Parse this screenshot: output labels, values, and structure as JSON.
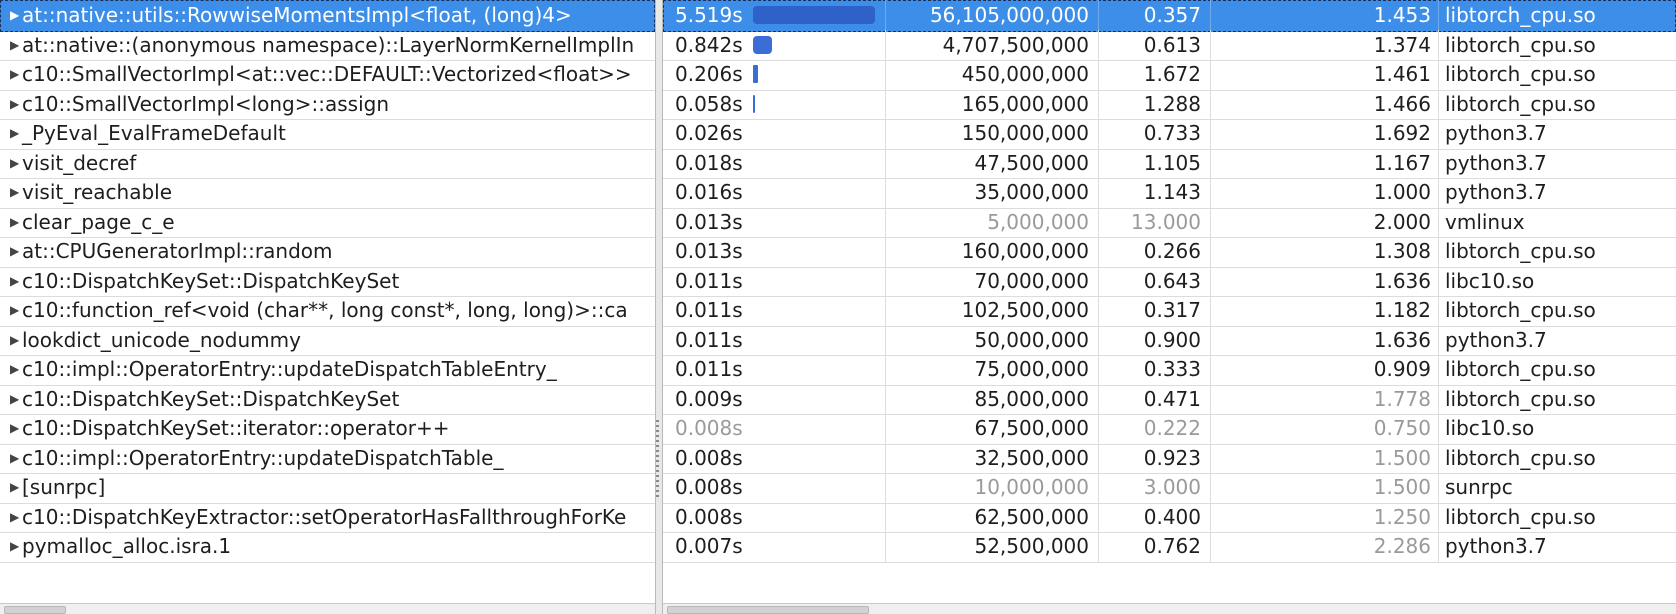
{
  "rows": [
    {
      "name": "at::native::utils::RowwiseMomentsImpl<float, (long)4>",
      "time": "5.519s",
      "time_frac": 1.0,
      "count": "56,105,000,000",
      "ipc": "0.357",
      "cpi": "1.453",
      "module": "libtorch_cpu.so",
      "selected": true
    },
    {
      "name": "at::native::(anonymous namespace)::LayerNormKernelImplIn",
      "time": "0.842s",
      "time_frac": 0.153,
      "count": "4,707,500,000",
      "ipc": "0.613",
      "cpi": "1.374",
      "module": "libtorch_cpu.so"
    },
    {
      "name": "c10::SmallVectorImpl<at::vec::DEFAULT::Vectorized<float>>",
      "time": "0.206s",
      "time_frac": 0.037,
      "count": "450,000,000",
      "ipc": "1.672",
      "cpi": "1.461",
      "module": "libtorch_cpu.so"
    },
    {
      "name": "c10::SmallVectorImpl<long>::assign",
      "time": "0.058s",
      "time_frac": 0.011,
      "count": "165,000,000",
      "ipc": "1.288",
      "cpi": "1.466",
      "module": "libtorch_cpu.so"
    },
    {
      "name": "_PyEval_EvalFrameDefault",
      "time": "0.026s",
      "time_frac": 0,
      "count": "150,000,000",
      "ipc": "0.733",
      "cpi": "1.692",
      "module": "python3.7"
    },
    {
      "name": "visit_decref",
      "time": "0.018s",
      "time_frac": 0,
      "count": "47,500,000",
      "ipc": "1.105",
      "cpi": "1.167",
      "module": "python3.7"
    },
    {
      "name": "visit_reachable",
      "time": "0.016s",
      "time_frac": 0,
      "count": "35,000,000",
      "ipc": "1.143",
      "cpi": "1.000",
      "module": "python3.7"
    },
    {
      "name": "clear_page_c_e",
      "time": "0.013s",
      "time_frac": 0,
      "count": "5,000,000",
      "ipc": "13.000",
      "cpi": "2.000",
      "module": "vmlinux",
      "dim": [
        "count",
        "ipc"
      ]
    },
    {
      "name": "at::CPUGeneratorImpl::random",
      "time": "0.013s",
      "time_frac": 0,
      "count": "160,000,000",
      "ipc": "0.266",
      "cpi": "1.308",
      "module": "libtorch_cpu.so"
    },
    {
      "name": "c10::DispatchKeySet::DispatchKeySet",
      "time": "0.011s",
      "time_frac": 0,
      "count": "70,000,000",
      "ipc": "0.643",
      "cpi": "1.636",
      "module": "libc10.so"
    },
    {
      "name": "c10::function_ref<void (char**, long const*, long, long)>::ca",
      "time": "0.011s",
      "time_frac": 0,
      "count": "102,500,000",
      "ipc": "0.317",
      "cpi": "1.182",
      "module": "libtorch_cpu.so"
    },
    {
      "name": "lookdict_unicode_nodummy",
      "time": "0.011s",
      "time_frac": 0,
      "count": "50,000,000",
      "ipc": "0.900",
      "cpi": "1.636",
      "module": "python3.7"
    },
    {
      "name": "c10::impl::OperatorEntry::updateDispatchTableEntry_",
      "time": "0.011s",
      "time_frac": 0,
      "count": "75,000,000",
      "ipc": "0.333",
      "cpi": "0.909",
      "module": "libtorch_cpu.so"
    },
    {
      "name": "c10::DispatchKeySet::DispatchKeySet",
      "time": "0.009s",
      "time_frac": 0,
      "count": "85,000,000",
      "ipc": "0.471",
      "cpi": "1.778",
      "module": "libtorch_cpu.so",
      "dim": [
        "cpi"
      ]
    },
    {
      "name": "c10::DispatchKeySet::iterator::operator++",
      "time": "0.008s",
      "time_frac": 0,
      "count": "67,500,000",
      "ipc": "0.222",
      "cpi": "0.750",
      "module": "libc10.so",
      "dim": [
        "time",
        "ipc",
        "cpi"
      ]
    },
    {
      "name": "c10::impl::OperatorEntry::updateDispatchTable_",
      "time": "0.008s",
      "time_frac": 0,
      "count": "32,500,000",
      "ipc": "0.923",
      "cpi": "1.500",
      "module": "libtorch_cpu.so",
      "dim": [
        "cpi"
      ]
    },
    {
      "name": "[sunrpc]",
      "time": "0.008s",
      "time_frac": 0,
      "count": "10,000,000",
      "ipc": "3.000",
      "cpi": "1.500",
      "module": "sunrpc",
      "dim": [
        "count",
        "ipc",
        "cpi"
      ]
    },
    {
      "name": "c10::DispatchKeyExtractor::setOperatorHasFallthroughForKe",
      "time": "0.008s",
      "time_frac": 0,
      "count": "62,500,000",
      "ipc": "0.400",
      "cpi": "1.250",
      "module": "libtorch_cpu.so",
      "dim": [
        "cpi"
      ]
    },
    {
      "name": "pymalloc_alloc.isra.1",
      "time": "0.007s",
      "time_frac": 0,
      "count": "52,500,000",
      "ipc": "0.762",
      "cpi": "2.286",
      "module": "python3.7",
      "dim": [
        "cpi"
      ]
    }
  ],
  "colors": {
    "selection": "#3d8ee8",
    "bar": "#3a6ed6",
    "dim_text": "#9a9a9a",
    "grid": "#dcdcdc"
  },
  "icons": {
    "expander": "triangle-right-icon"
  }
}
